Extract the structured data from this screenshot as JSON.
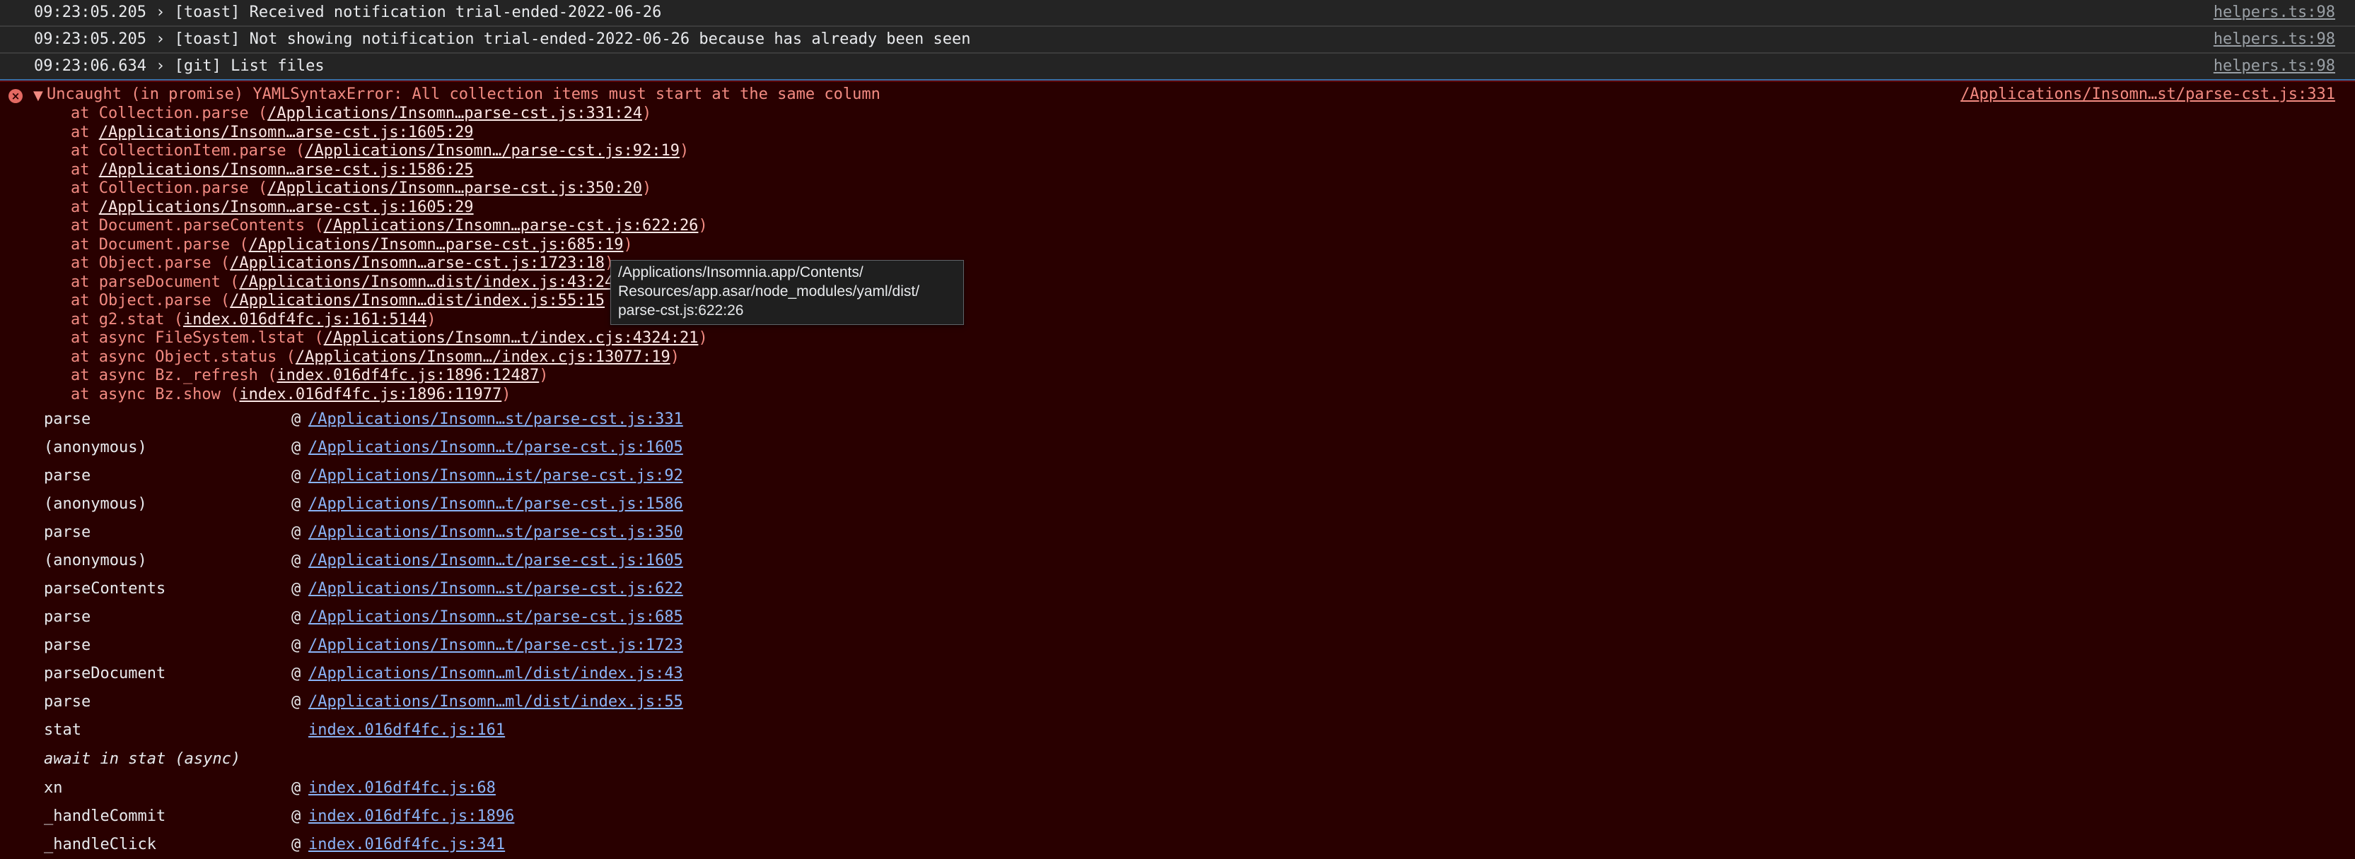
{
  "log_rows": [
    {
      "text": "09:23:05.205 › [toast] Received notification trial-ended-2022-06-26",
      "source": "helpers.ts:98"
    },
    {
      "text": "09:23:05.205 › [toast] Not showing notification trial-ended-2022-06-26 because has already been seen",
      "source": "helpers.ts:98"
    },
    {
      "text": "09:23:06.634 › [git] List files",
      "source": "helpers.ts:98"
    }
  ],
  "error": {
    "message": "Uncaught (in promise) YAMLSyntaxError: All collection items must start at the same column",
    "source": "/Applications/Insomn…st/parse-cst.js:331",
    "trace": [
      {
        "prefix": "at Collection.parse (",
        "link": "/Applications/Insomn…parse-cst.js:331:24",
        "suffix": ")"
      },
      {
        "prefix": "at ",
        "link": "/Applications/Insomn…arse-cst.js:1605:29",
        "suffix": ""
      },
      {
        "prefix": "at CollectionItem.parse (",
        "link": "/Applications/Insomn…/parse-cst.js:92:19",
        "suffix": ")"
      },
      {
        "prefix": "at ",
        "link": "/Applications/Insomn…arse-cst.js:1586:25",
        "suffix": ""
      },
      {
        "prefix": "at Collection.parse (",
        "link": "/Applications/Insomn…parse-cst.js:350:20",
        "suffix": ")"
      },
      {
        "prefix": "at ",
        "link": "/Applications/Insomn…arse-cst.js:1605:29",
        "suffix": ""
      },
      {
        "prefix": "at Document.parseContents (",
        "link": "/Applications/Insomn…parse-cst.js:622:26",
        "suffix": ")"
      },
      {
        "prefix": "at Document.parse (",
        "link": "/Applications/Insomn…parse-cst.js:685:19",
        "suffix": ")"
      },
      {
        "prefix": "at Object.parse (",
        "link": "/Applications/Insomn…arse-cst.js:1723:18",
        "suffix": ")"
      },
      {
        "prefix": "at parseDocument (",
        "link": "/Applications/Insomn…dist/index.js:43:24",
        "suffix": ""
      },
      {
        "prefix": "at Object.parse (",
        "link": "/Applications/Insomn…dist/index.js:55:15",
        "suffix": ""
      },
      {
        "prefix": "at g2.stat (",
        "link": "index.016df4fc.js:161:5144",
        "suffix": ")"
      },
      {
        "prefix": "at async FileSystem.lstat (",
        "link": "/Applications/Insomn…t/index.cjs:4324:21",
        "suffix": ")"
      },
      {
        "prefix": "at async Object.status (",
        "link": "/Applications/Insomn…/index.cjs:13077:19",
        "suffix": ")"
      },
      {
        "prefix": "at async Bz._refresh (",
        "link": "index.016df4fc.js:1896:12487",
        "suffix": ")"
      },
      {
        "prefix": "at async Bz.show (",
        "link": "index.016df4fc.js:1896:11977",
        "suffix": ")"
      }
    ]
  },
  "tooltip": {
    "lines": [
      "/Applications/Insomnia.app/Contents/",
      "Resources/app.asar/node_modules/yaml/dist/",
      "parse-cst.js:622:26"
    ]
  },
  "stack": [
    {
      "fn": "parse",
      "link": "/Applications/Insomn…st/parse-cst.js:331"
    },
    {
      "fn": "(anonymous)",
      "link": "/Applications/Insomn…t/parse-cst.js:1605"
    },
    {
      "fn": "parse",
      "link": "/Applications/Insomn…ist/parse-cst.js:92"
    },
    {
      "fn": "(anonymous)",
      "link": "/Applications/Insomn…t/parse-cst.js:1586"
    },
    {
      "fn": "parse",
      "link": "/Applications/Insomn…st/parse-cst.js:350"
    },
    {
      "fn": "(anonymous)",
      "link": "/Applications/Insomn…t/parse-cst.js:1605"
    },
    {
      "fn": "parseContents",
      "link": "/Applications/Insomn…st/parse-cst.js:622"
    },
    {
      "fn": "parse",
      "link": "/Applications/Insomn…st/parse-cst.js:685"
    },
    {
      "fn": "parse",
      "link": "/Applications/Insomn…t/parse-cst.js:1723"
    },
    {
      "fn": "parseDocument",
      "link": "/Applications/Insomn…ml/dist/index.js:43"
    },
    {
      "fn": "parse",
      "link": "/Applications/Insomn…ml/dist/index.js:55"
    },
    {
      "fn": "stat",
      "link": "index.016df4fc.js:161",
      "no_at": true
    }
  ],
  "async_label": "await in stat (async)",
  "stack_after": [
    {
      "fn": "xn",
      "link": "index.016df4fc.js:68"
    },
    {
      "fn": "_handleCommit",
      "link": "index.016df4fc.js:1896"
    },
    {
      "fn": "_handleClick",
      "link": "index.016df4fc.js:341"
    }
  ],
  "at_symbol": "@"
}
